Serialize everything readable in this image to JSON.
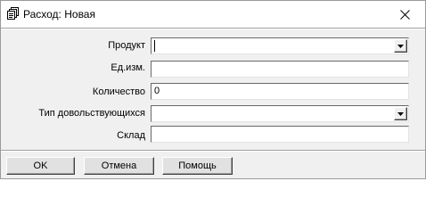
{
  "window": {
    "title": "Расход: Новая",
    "icon": "document-stack-icon",
    "close_icon": "close-icon"
  },
  "form": {
    "fields": [
      {
        "label": "Продукт",
        "type": "combobox",
        "value": ""
      },
      {
        "label": "Ед.изм.",
        "type": "text",
        "value": ""
      },
      {
        "label": "Количество",
        "type": "text",
        "value": "0"
      },
      {
        "label": "Тип довольствующихся",
        "type": "combobox",
        "value": ""
      },
      {
        "label": "Склад",
        "type": "text",
        "value": ""
      }
    ]
  },
  "buttons": {
    "ok": "OK",
    "cancel": "Отмена",
    "help": "Помощь"
  }
}
